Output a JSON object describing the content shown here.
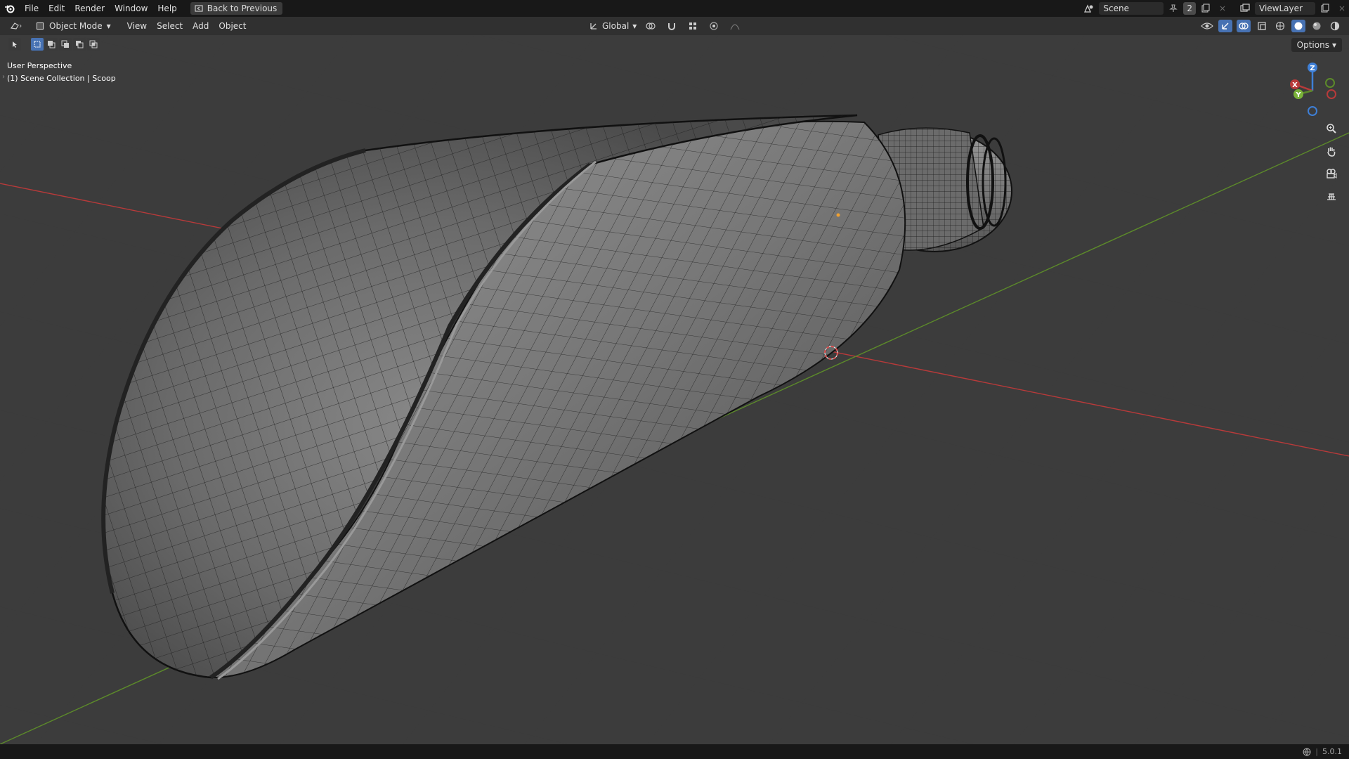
{
  "menu": {
    "items": [
      "File",
      "Edit",
      "Render",
      "Window",
      "Help"
    ],
    "back_label": "Back to Previous"
  },
  "top_right": {
    "scene_label": "Scene",
    "scene_users": "2",
    "view_layer_label": "ViewLayer"
  },
  "header": {
    "mode_label": "Object Mode",
    "menus": [
      "View",
      "Select",
      "Add",
      "Object"
    ],
    "transform_orientation": "Global",
    "options_label": "Options"
  },
  "viewport": {
    "perspective_label": "User Perspective",
    "collection_label": "(1) Scene Collection | Scoop"
  },
  "gizmo": {
    "z_label": "Z",
    "x_label": "X",
    "y_label": "Y"
  },
  "status": {
    "version": "5.0.1"
  },
  "colors": {
    "axis_x": "#b83a3a",
    "axis_y": "#5c8a2a",
    "axis_z": "#3e7fd6",
    "header_bg": "#303030",
    "topbar_bg": "#181818",
    "accent": "#4772b3"
  }
}
